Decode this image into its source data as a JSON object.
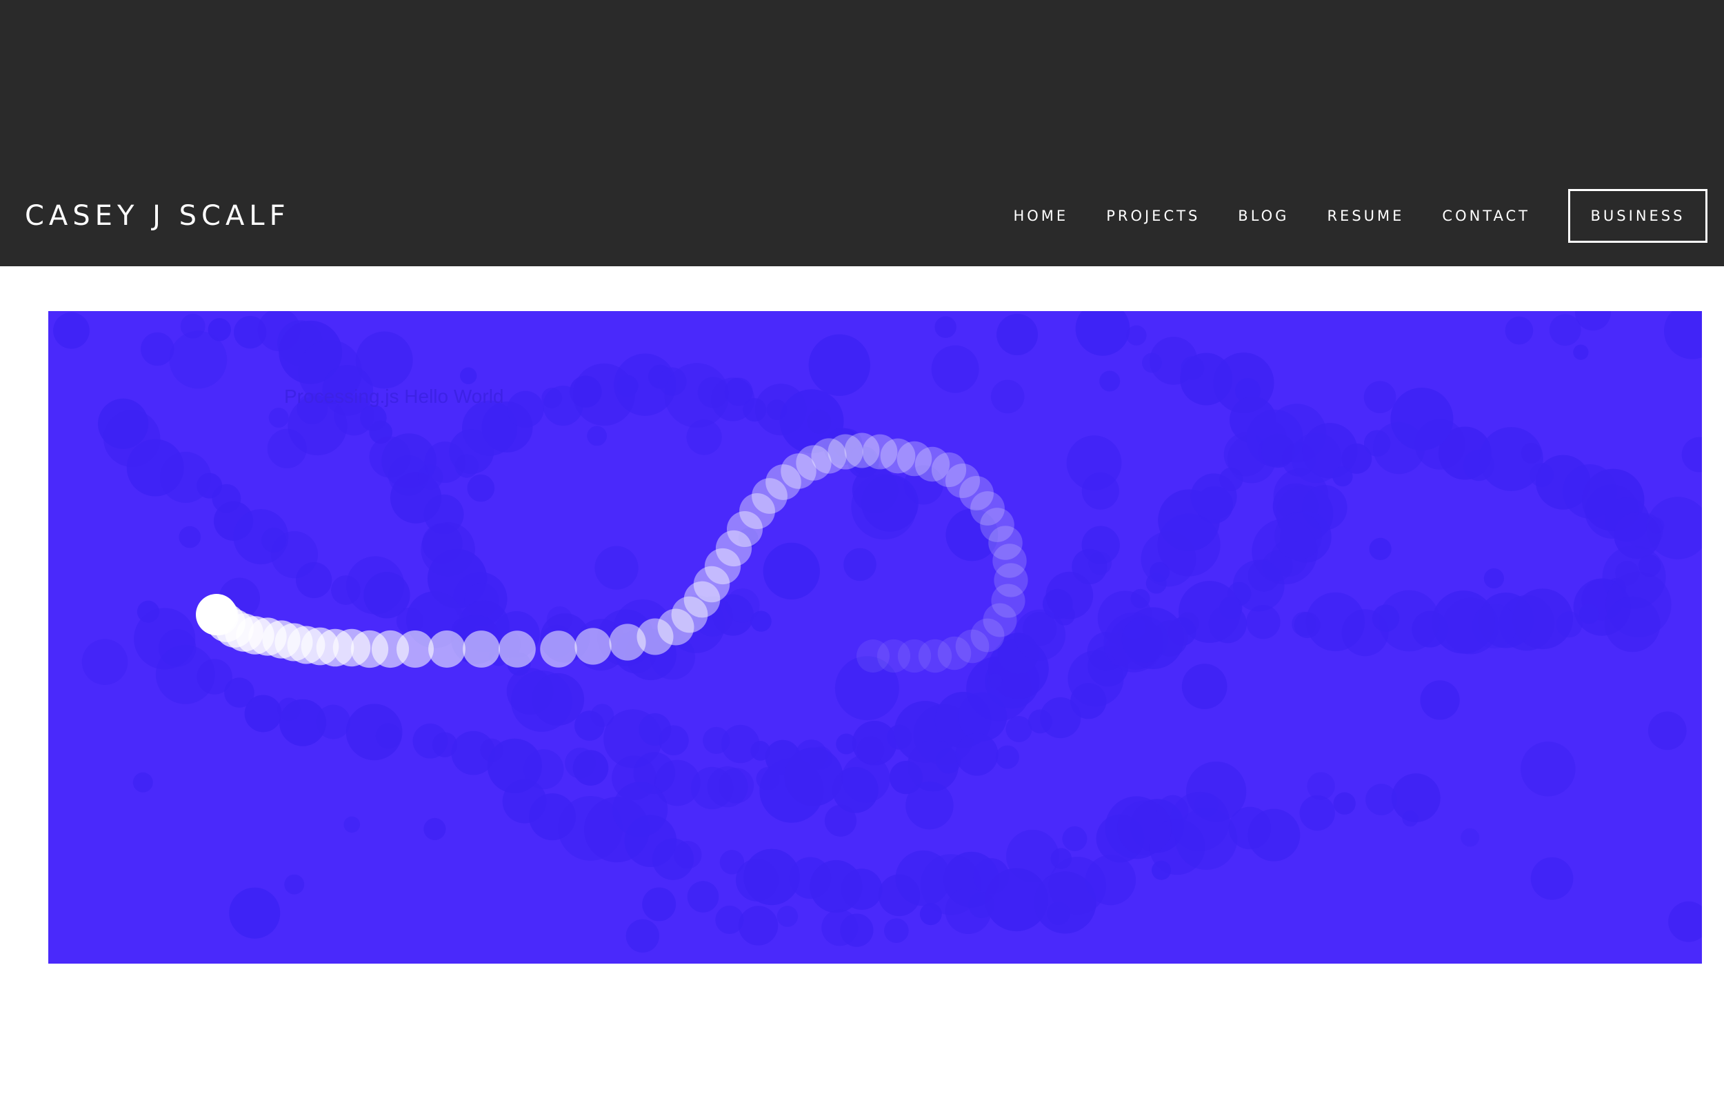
{
  "header": {
    "site_title": "CASEY J SCALF",
    "nav": [
      {
        "label": "HOME"
      },
      {
        "label": "PROJECTS"
      },
      {
        "label": "BLOG"
      },
      {
        "label": "RESUME"
      },
      {
        "label": "CONTACT"
      }
    ],
    "cta_label": "BUSINESS"
  },
  "sketch": {
    "caption": "Processing.js Hello World",
    "colors": {
      "background": "#4a29fb",
      "trail_dark": "#3d22f4",
      "trail_light": "#ffffff"
    }
  }
}
